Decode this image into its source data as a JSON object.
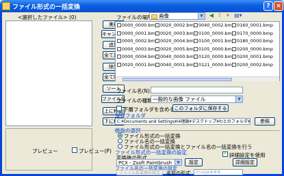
{
  "window": {
    "title": "ファイル形式の一括変換",
    "help": "?",
    "close": "×"
  },
  "selection": {
    "label": "<選択したファイル> (0)",
    "buttons": [
      "実行",
      "キャンセル",
      "追加",
      "全て追加",
      "除外",
      "全て除外",
      "ソート",
      "ファイル読込",
      "上に移動",
      "下に移動"
    ]
  },
  "preview": {
    "label": "プレビュー",
    "checkbox_label": "プレビュー(P)"
  },
  "browser": {
    "location_label": "ファイルの場所(I):",
    "location_value": "画像",
    "files": [
      [
        "0000_0000.bmp",
        "0020_0002.bmp",
        "0040_0002.bmp",
        "0160_0001.bmp"
      ],
      [
        "0000_0001.bmp",
        "0020_0003.bmp",
        "0100_0000.bmp",
        "0170_0000.bmp"
      ],
      [
        "0000_0002.bmp",
        "0020_0004.bmp",
        "0100_0001.bmp",
        "0180_0000.bmp"
      ],
      [
        "0000_0003.bmp",
        "0020_0005.bmp",
        "0105_0000.bmp",
        "0200_0000.bmp"
      ],
      [
        "0000_0004.bmp",
        "0040_0000.bmp",
        "0120_0000.bmp",
        "0200_0001.bmp"
      ],
      [
        "0020_0001.bmp",
        "0040_0001.bmp",
        "0121_0000.bmp",
        "0200_0002.bmp"
      ]
    ],
    "filename_label": "ファイル名(N):",
    "filename_value": "",
    "filetype_label": "ファイルの種類(T):",
    "filetype_value": "一般的な画像 ファイル"
  },
  "subfolder": {
    "label": "下層フォルダを含める(B)",
    "save_list_button": "このフォルダに保存する"
  },
  "save_folder": {
    "label": "保存フォルダ",
    "path": "C:¥Documents and Settings¥i4理論¥デスクトップ¥わとのフォルダ¥nuzenjk",
    "browse": "参照"
  },
  "function": {
    "label": "機能の選択",
    "options": [
      "ファイル形式の一括変換",
      "ファイル名の一括変換",
      "ファイル形式の一括変換とファイル名の一括変換を行う"
    ],
    "selected": 0
  },
  "convert": {
    "section_label": "ファイル形式の一括変換の設定",
    "format_label": "変換後の形式",
    "format_value": "PCX - Zsoft Paintbrush",
    "settings_button": "設定",
    "detail_checkbox": "詳細設定を使用",
    "detail_button": "詳細設定"
  },
  "rename": {
    "section_label": "ファイル名の一括変換の設定",
    "settings_button": "ファイル名変換の設定",
    "format_label": "名前の形式",
    "format_value": "image###"
  }
}
